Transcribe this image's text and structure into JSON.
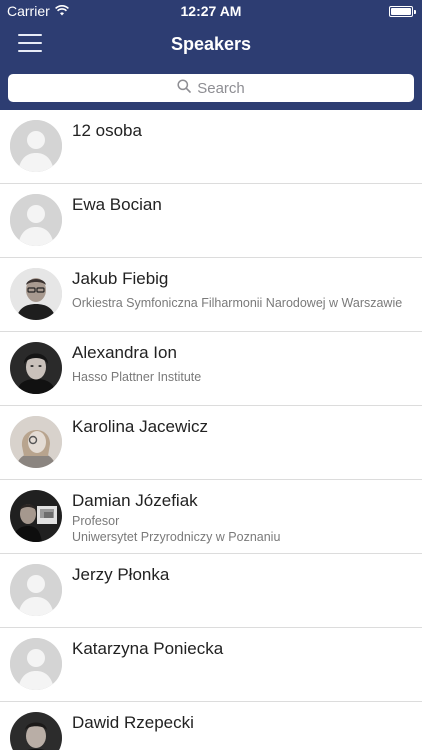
{
  "status": {
    "carrier": "Carrier",
    "time": "12:27 AM"
  },
  "nav": {
    "title": "Speakers"
  },
  "search": {
    "placeholder": "Search"
  },
  "speakers": [
    {
      "name": "12 osoba",
      "role": "",
      "org": "",
      "avatar": "placeholder"
    },
    {
      "name": "Ewa Bocian",
      "role": "",
      "org": "",
      "avatar": "placeholder"
    },
    {
      "name": "Jakub Fiebig",
      "role": "",
      "org": "Orkiestra Symfoniczna Filharmonii Narodowej w Warszawie",
      "avatar": "photo-man-glasses"
    },
    {
      "name": "Alexandra Ion",
      "role": "",
      "org": "Hasso Plattner Institute",
      "avatar": "photo-woman-dark-hair"
    },
    {
      "name": "Karolina Jacewicz",
      "role": "",
      "org": "",
      "avatar": "photo-woman-blonde"
    },
    {
      "name": "Damian Józefiak",
      "role": "Profesor",
      "org": "Uniwersytet Przyrodniczy w Poznaniu",
      "avatar": "photo-man-screen"
    },
    {
      "name": "Jerzy Płonka",
      "role": "",
      "org": "",
      "avatar": "placeholder"
    },
    {
      "name": "Katarzyna Poniecka",
      "role": "",
      "org": "",
      "avatar": "placeholder"
    },
    {
      "name": "Dawid Rzepecki",
      "role": "",
      "org": "",
      "avatar": "photo-man-dark"
    }
  ]
}
